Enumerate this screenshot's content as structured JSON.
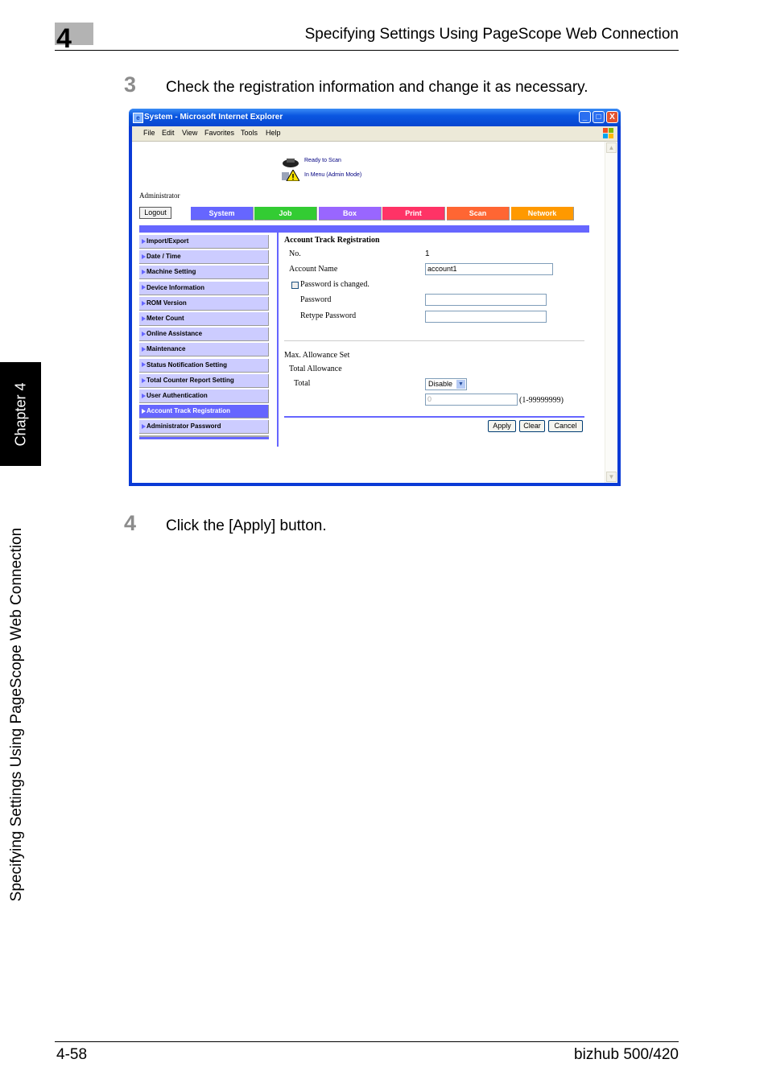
{
  "page": {
    "chapter_number": "4",
    "header_title": "Specifying Settings Using PageScope Web Connection",
    "side_tab": "Chapter 4",
    "side_text": "Specifying Settings Using PageScope Web Connection",
    "footer_page": "4-58",
    "footer_model": "bizhub 500/420"
  },
  "steps": [
    {
      "number": "3",
      "text": "Check the registration information and change it as necessary."
    },
    {
      "number": "4",
      "text": "Click the [Apply] button."
    }
  ],
  "browser": {
    "title": "System - Microsoft Internet Explorer",
    "controls": {
      "minimize": "_",
      "maximize": "□",
      "close": "X"
    },
    "menu": [
      "File",
      "Edit",
      "View",
      "Favorites",
      "Tools",
      "Help"
    ]
  },
  "webpage": {
    "status": [
      {
        "icon": "scanner-icon",
        "text": "Ready to Scan"
      },
      {
        "icon": "warning-icon",
        "text": "In Menu (Admin Mode)"
      }
    ],
    "user_label": "Administrator",
    "logout_label": "Logout",
    "tabs": [
      {
        "label": "System",
        "color": "#6666ff"
      },
      {
        "label": "Job",
        "color": "#33cc33"
      },
      {
        "label": "Box",
        "color": "#9966ff"
      },
      {
        "label": "Print",
        "color": "#ff3366"
      },
      {
        "label": "Scan",
        "color": "#ff6633"
      },
      {
        "label": "Network",
        "color": "#ff9900"
      }
    ],
    "sidebar": [
      {
        "label": "Import/Export",
        "active": false
      },
      {
        "label": "Date / Time",
        "active": false
      },
      {
        "label": "Machine Setting",
        "active": false
      },
      {
        "label": "Device Information",
        "active": false
      },
      {
        "label": "ROM Version",
        "active": false
      },
      {
        "label": "Meter Count",
        "active": false
      },
      {
        "label": "Online Assistance",
        "active": false
      },
      {
        "label": "Maintenance",
        "active": false
      },
      {
        "label": "Status Notification Setting",
        "active": false
      },
      {
        "label": "Total Counter Report Setting",
        "active": false
      },
      {
        "label": "User Authentication",
        "active": false
      },
      {
        "label": "Account Track Registration",
        "active": true
      },
      {
        "label": "Administrator Password",
        "active": false
      }
    ],
    "form": {
      "title": "Account Track Registration",
      "no_label": "No.",
      "no_value": "1",
      "account_name_label": "Account Name",
      "account_name_value": "account1",
      "password_changed_label": "Password is changed.",
      "password_changed_checked": false,
      "password_label": "Password",
      "password_value": "",
      "retype_password_label": "Retype Password",
      "retype_password_value": "",
      "max_allowance_label": "Max. Allowance Set",
      "total_allowance_label": "Total Allowance",
      "total_label": "Total",
      "total_select_value": "Disable",
      "total_input_value": "0",
      "total_range": "(1-99999999)",
      "apply_label": "Apply",
      "clear_label": "Clear",
      "cancel_label": "Cancel"
    }
  }
}
